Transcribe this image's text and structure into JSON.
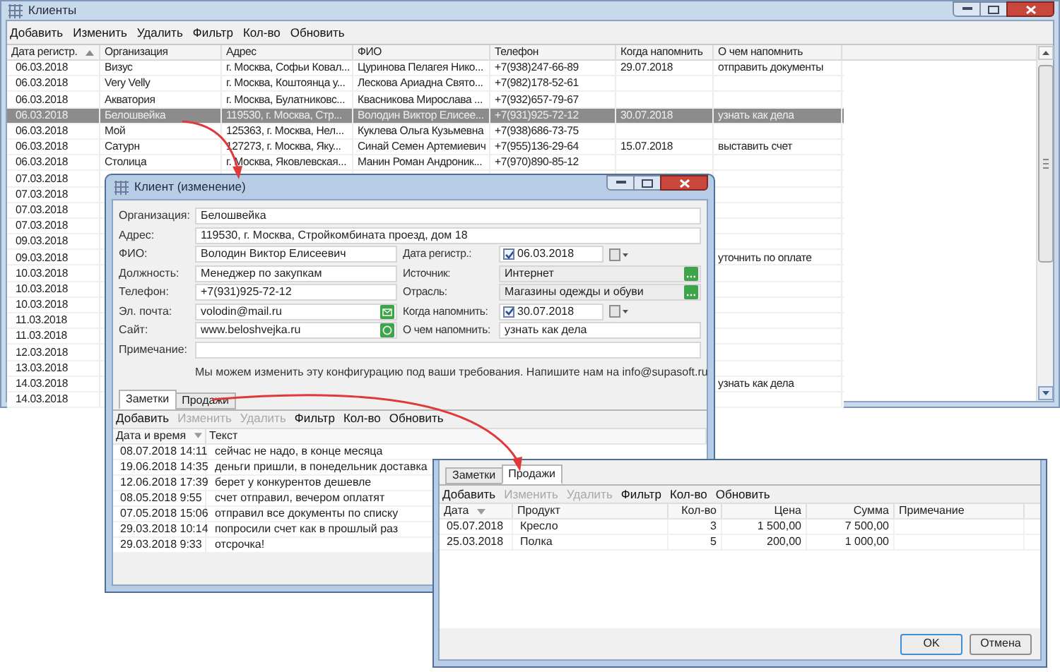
{
  "main_window": {
    "title": "Клиенты",
    "toolbar": [
      "Добавить",
      "Изменить",
      "Удалить",
      "Фильтр",
      "Кол-во",
      "Обновить"
    ],
    "columns": [
      "Дата регистр.",
      "Организация",
      "Адрес",
      "ФИО",
      "Телефон",
      "Когда напомнить",
      "О чем напомнить"
    ],
    "rows": [
      {
        "selected": false,
        "date": "06.03.2018",
        "organization": "Визус",
        "address": "г. Москва, Софьи Ковал...",
        "name": "Цуринова Пелагея Нико...",
        "phone": "+7(938)247-66-89",
        "remind_date": "29.07.2018",
        "remind_note": "отправить документы"
      },
      {
        "selected": false,
        "date": "06.03.2018",
        "organization": "Very Velly",
        "address": "г. Москва, Коштоянца у...",
        "name": "Лескова Ариадна Свято...",
        "phone": "+7(982)178-52-61"
      },
      {
        "selected": false,
        "date": "06.03.2018",
        "organization": "Акватория",
        "address": "г. Москва, Булатниковс...",
        "name": "Квасникова Мирослава ...",
        "phone": "+7(932)657-79-67"
      },
      {
        "selected": true,
        "date": "06.03.2018",
        "organization": "Белошвейка",
        "address": "119530, г. Москва, Стр...",
        "name": "Володин Виктор Елисее...",
        "phone": "+7(931)925-72-12",
        "remind_date": "30.07.2018",
        "remind_note": "узнать как дела"
      },
      {
        "selected": false,
        "date": "06.03.2018",
        "organization": "Мой",
        "address": "125363, г. Москва, Нел...",
        "name": "Куклева Ольга Кузьмевна",
        "phone": "+7(938)686-73-75"
      },
      {
        "selected": false,
        "date": "06.03.2018",
        "organization": "Сатурн",
        "address": "127273, г. Москва, Яку...",
        "name": "Синай Семен Артемиевич",
        "phone": "+7(955)136-29-64",
        "remind_date": "15.07.2018",
        "remind_note": "выставить счет"
      },
      {
        "selected": false,
        "date": "06.03.2018",
        "organization": "Столица",
        "address": "г. Москва, Яковлевская...",
        "name": "Манин Роман Андроник...",
        "phone": "+7(970)890-85-12"
      },
      {
        "selected": false,
        "date": "07.03.2018"
      },
      {
        "selected": false,
        "date": "07.03.2018"
      },
      {
        "selected": false,
        "date": "07.03.2018"
      },
      {
        "selected": false,
        "date": "07.03.2018"
      },
      {
        "selected": false,
        "date": "09.03.2018"
      },
      {
        "selected": false,
        "date": "09.03.2018",
        "remind_note": "уточнить по оплате"
      },
      {
        "selected": false,
        "date": "10.03.2018"
      },
      {
        "selected": false,
        "date": "10.03.2018"
      },
      {
        "selected": false,
        "date": "10.03.2018"
      },
      {
        "selected": false,
        "date": "11.03.2018"
      },
      {
        "selected": false,
        "date": "11.03.2018"
      },
      {
        "selected": false,
        "date": "12.03.2018"
      },
      {
        "selected": false,
        "date": "13.03.2018"
      },
      {
        "selected": false,
        "date": "14.03.2018",
        "remind_note": "узнать как дела"
      },
      {
        "selected": false,
        "date": "14.03.2018"
      }
    ]
  },
  "client_dialog": {
    "title": "Клиент (изменение)",
    "form_rows": [
      {
        "left": {
          "kind": "wide",
          "label": "Организация:",
          "value": "Белошвейка"
        }
      },
      {
        "left": {
          "kind": "wide",
          "label": "Адрес:",
          "value": "119530, г. Москва, Стройкомбината проезд, дом 18"
        }
      },
      {
        "left": {
          "kind": "text",
          "label": "ФИО:",
          "value": "Володин Виктор Елисеевич"
        },
        "right": {
          "kind": "date",
          "label": "Дата регистр.:",
          "value": "06.03.2018",
          "checked": true
        }
      },
      {
        "left": {
          "kind": "text",
          "label": "Должность:",
          "value": "Менеджер по закупкам"
        },
        "right": {
          "kind": "lookup",
          "label": "Источник:",
          "value": "Интернет"
        }
      },
      {
        "left": {
          "kind": "text",
          "label": "Телефон:",
          "value": "+7(931)925-72-12"
        },
        "right": {
          "kind": "lookup",
          "label": "Отрасль:",
          "value": "Магазины одежды и обуви"
        }
      },
      {
        "left": {
          "kind": "email",
          "label": "Эл. почта:",
          "value": "volodin@mail.ru"
        },
        "right": {
          "kind": "date",
          "label": "Когда напомнить:",
          "value": "30.07.2018",
          "checked": true
        }
      },
      {
        "left": {
          "kind": "site",
          "label": "Сайт:",
          "value": "www.beloshvejka.ru"
        },
        "right": {
          "kind": "text",
          "label": "О чем напомнить:",
          "value": "узнать как дела"
        }
      },
      {
        "left": {
          "kind": "wide",
          "label": "Примечание:"
        }
      }
    ],
    "notice": "Мы можем изменить эту конфигурацию под ваши требования. Напишите нам на info@supasoft.ru",
    "tabs": [
      {
        "label": "Заметки",
        "selected": true
      },
      {
        "label": "Продажи",
        "selected": false
      }
    ],
    "toolbar": [
      {
        "label": "Добавить",
        "disabled": false
      },
      {
        "label": "Изменить",
        "disabled": true
      },
      {
        "label": "Удалить",
        "disabled": true
      },
      {
        "label": "Фильтр",
        "disabled": false
      },
      {
        "label": "Кол-во",
        "disabled": false
      },
      {
        "label": "Обновить",
        "disabled": false
      }
    ],
    "notes_columns": [
      "Дата и время",
      "Текст"
    ],
    "notes": [
      [
        "08.07.2018 14:11",
        "сейчас не надо, в конце месяца"
      ],
      [
        "19.06.2018 14:35",
        "деньги пришли, в понедельник доставка"
      ],
      [
        "12.06.2018 17:39",
        "берет у конкурентов дешевле"
      ],
      [
        "08.05.2018 9:55",
        "счет отправил, вечером оплатят"
      ],
      [
        "07.05.2018 15:06",
        "отправил все документы по списку"
      ],
      [
        "29.03.2018 10:14",
        "попросили счет как в прошлый раз"
      ],
      [
        "29.03.2018 9:33",
        "отсрочка!"
      ]
    ]
  },
  "sales_panel": {
    "tabs": [
      {
        "label": "Заметки",
        "selected": false
      },
      {
        "label": "Продажи",
        "selected": true
      }
    ],
    "toolbar": [
      {
        "label": "Добавить",
        "disabled": false
      },
      {
        "label": "Изменить",
        "disabled": true
      },
      {
        "label": "Удалить",
        "disabled": true
      },
      {
        "label": "Фильтр",
        "disabled": false
      },
      {
        "label": "Кол-во",
        "disabled": false
      },
      {
        "label": "Обновить",
        "disabled": false
      }
    ],
    "columns": [
      "Дата",
      "Продукт",
      "Кол-во",
      "Цена",
      "Сумма",
      "Примечание"
    ],
    "rows": [
      [
        "05.07.2018",
        "Кресло",
        "3",
        "1 500,00",
        "7 500,00"
      ],
      [
        "25.03.2018",
        "Полка",
        "5",
        "200,00",
        "1 000,00"
      ]
    ],
    "buttons": [
      "OK",
      "Отмена"
    ]
  }
}
